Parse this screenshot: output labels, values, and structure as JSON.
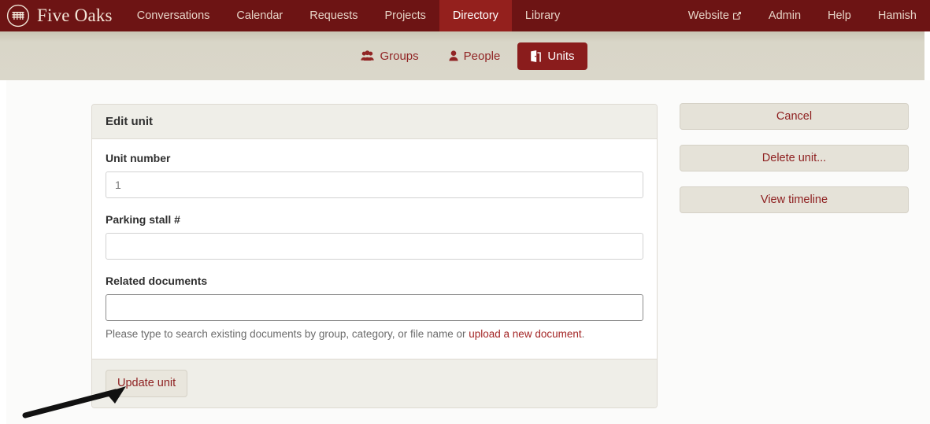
{
  "brand": {
    "name": "Five Oaks",
    "logo_icon": "building-circle-icon"
  },
  "topnav": {
    "items": [
      {
        "label": "Conversations",
        "active": false
      },
      {
        "label": "Calendar",
        "active": false
      },
      {
        "label": "Requests",
        "active": false
      },
      {
        "label": "Projects",
        "active": false
      },
      {
        "label": "Directory",
        "active": true
      },
      {
        "label": "Library",
        "active": false
      }
    ],
    "right_items": [
      {
        "label": "Website",
        "icon": "external-link-icon"
      },
      {
        "label": "Admin",
        "icon": ""
      },
      {
        "label": "Help",
        "icon": ""
      },
      {
        "label": "Hamish",
        "icon": ""
      }
    ],
    "colors": {
      "background": "#6d1414",
      "active_background": "#94201d",
      "text": "#e6d3c6"
    }
  },
  "subnav": {
    "tabs": [
      {
        "label": "Groups",
        "icon": "users-group-icon",
        "active": false
      },
      {
        "label": "People",
        "icon": "user-icon",
        "active": false
      },
      {
        "label": "Units",
        "icon": "door-open-icon",
        "active": true
      }
    ],
    "colors": {
      "background": "#d9d6c8",
      "link": "#912525",
      "active_background": "#8a1c1c"
    }
  },
  "card": {
    "title": "Edit unit",
    "fields": [
      {
        "label": "Unit number",
        "value": "1",
        "placeholder": "",
        "focused": false,
        "name": "unit-number"
      },
      {
        "label": "Parking stall #",
        "value": "",
        "placeholder": "",
        "focused": false,
        "name": "parking-stall"
      },
      {
        "label": "Related documents",
        "value": "",
        "placeholder": "",
        "focused": true,
        "name": "related-documents"
      }
    ],
    "help": {
      "text_before": "Please type to search existing documents by group, category, or file name or ",
      "link_label": "upload a new document",
      "text_after": "."
    },
    "submit_label": "Update unit"
  },
  "side_actions": [
    {
      "label": "Cancel",
      "name": "cancel-button"
    },
    {
      "label": "Delete unit...",
      "name": "delete-unit-button"
    },
    {
      "label": "View timeline",
      "name": "view-timeline-button"
    }
  ],
  "annotation": {
    "type": "arrow",
    "points_to": "related-documents-input"
  }
}
